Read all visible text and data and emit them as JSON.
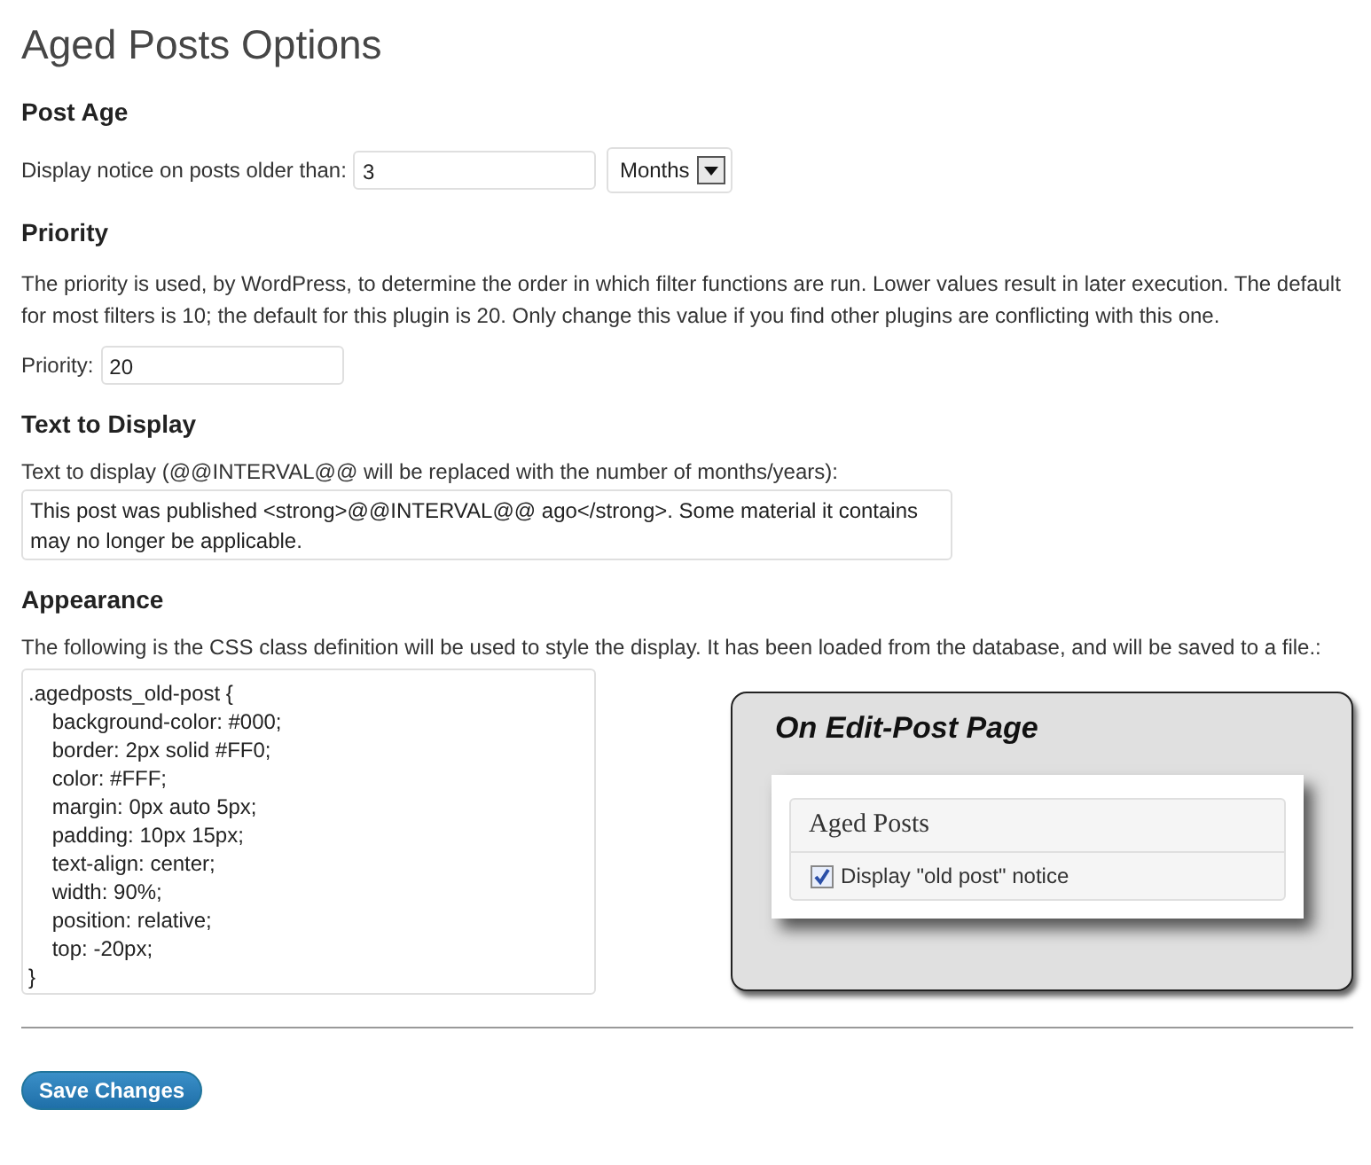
{
  "title": "Aged Posts Options",
  "post_age": {
    "heading": "Post Age",
    "label": "Display notice on posts older than:",
    "value": "3",
    "unit": "Months"
  },
  "priority": {
    "heading": "Priority",
    "description": "The priority is used, by WordPress, to determine the order in which filter functions are run. Lower values result in later execution. The default for most filters is 10; the default for this plugin is 20. Only change this value if you find other plugins are conflicting with this one.",
    "label": "Priority:",
    "value": "20"
  },
  "text_to_display": {
    "heading": "Text to Display",
    "label": "Text to display (@@INTERVAL@@ will be replaced with the number of months/years):",
    "value": "This post was published <strong>@@INTERVAL@@ ago</strong>. Some material it contains may no longer be applicable."
  },
  "appearance": {
    "heading": "Appearance",
    "description": "The following is the CSS class definition will be used to style the display. It has been loaded from the database, and will be saved to a file.:",
    "css": ".agedposts_old-post {\n    background-color: #000;\n    border: 2px solid #FF0;\n    color: #FFF;\n    margin: 0px auto 5px;\n    padding: 10px 15px;\n    text-align: center;\n    width: 90%;\n    position: relative;\n    top: -20px;\n}",
    "preview": {
      "title": "On Edit-Post Page",
      "box_title": "Aged Posts",
      "checkbox": {
        "label": "Display \"old post\" notice",
        "checked": true
      }
    }
  },
  "save_button": "Save Changes"
}
